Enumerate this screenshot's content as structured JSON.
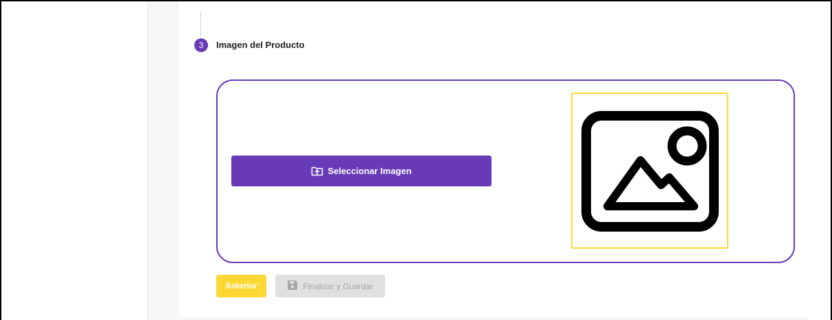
{
  "step": {
    "number": "3",
    "title": "Imagen del Producto"
  },
  "upload": {
    "select_label": "Seleccionar Imagen",
    "select_icon": "folder-upload-icon",
    "preview_icon": "image-placeholder-icon"
  },
  "footer": {
    "prev_label": "Anterior",
    "finish_label": "Finalizar y Guardar",
    "finish_icon": "save-icon"
  },
  "colors": {
    "primary": "#673ab7",
    "accent": "#fdd835",
    "disabled": "#e0e0e0"
  }
}
